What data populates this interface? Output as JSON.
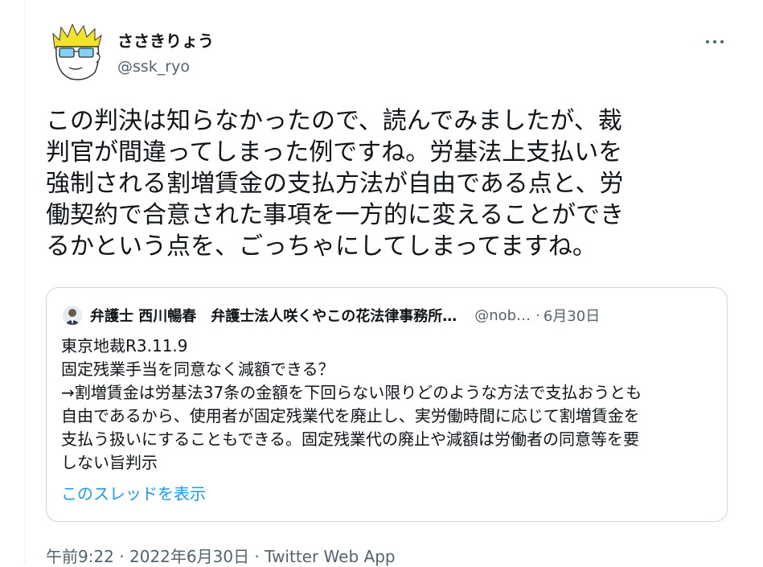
{
  "tweet": {
    "display_name": "ささきりょう",
    "handle": "@ssk_ryo",
    "lines": [
      "この判決は知らなかったので、読んでみましたが、裁",
      "判官が間違ってしまった例ですね。労基法上支払いを",
      "強制される割増賃金の支払方法が自由である点と、労",
      "働契約で合意された事項を一方的に変えることができ",
      "るかという点を、ごっちゃにしてしまってますね。"
    ],
    "more_icon": "more-horizontal-icon"
  },
  "quote": {
    "name": "弁護士 西川暢春　弁護士法人咲くやこの花法律事務所…",
    "handle": "@nob…",
    "dot": "·",
    "date": "6月30日",
    "lines": [
      "東京地裁R3.11.9",
      "固定残業手当を同意なく減額できる？",
      "→割増賃金は労基法37条の金額を下回らない限りどのような方法で支払おうとも",
      "自由であるから、使用者が固定残業代を廃止し、実労働時間に応じて割増賃金を",
      "支払う扱いにすることもできる。固定残業代の廃止や減額は労働者の同意等を要",
      "しない旨判示"
    ],
    "show_thread": "このスレッドを表示"
  },
  "meta": {
    "time": "午前9:22",
    "sep1": " · ",
    "date": "2022年6月30日",
    "sep2": " · ",
    "app": "Twitter Web App"
  },
  "colors": {
    "text": "#0f1419",
    "secondary": "#536471",
    "link": "#1d9bf0",
    "border": "#cfd9de"
  }
}
